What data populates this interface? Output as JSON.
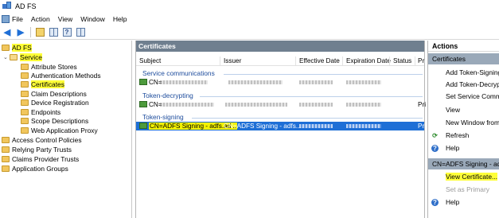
{
  "window": {
    "title": "AD FS"
  },
  "menu": [
    "File",
    "Action",
    "View",
    "Window",
    "Help"
  ],
  "tree": {
    "root": "AD FS",
    "service": "Service",
    "service_children": [
      "Attribute Stores",
      "Authentication Methods",
      "Certificates",
      "Claim Descriptions",
      "Device Registration",
      "Endpoints",
      "Scope Descriptions",
      "Web Application Proxy"
    ],
    "root_children": [
      "Access Control Policies",
      "Relying Party Trusts",
      "Claims Provider Trusts",
      "Application Groups"
    ]
  },
  "center": {
    "title": "Certificates",
    "columns": [
      "Subject",
      "Issuer",
      "Effective Date",
      "Expiration Date",
      "Status",
      "Pr"
    ],
    "groups": [
      {
        "label": "Service communications",
        "subject_prefix": "CN=",
        "issuer": "",
        "pr": ""
      },
      {
        "label": "Token-decrypting",
        "subject_prefix": "CN=",
        "issuer": "",
        "pr": "Pri"
      },
      {
        "label": "Token-signing",
        "subject": "CN=ADFS Signing - adfs.ad...",
        "issuer": "CN=ADFS Signing - adfs....",
        "pr": "Pri"
      }
    ]
  },
  "actions": {
    "title": "Actions",
    "group1": "Certificates",
    "items1": [
      "Add Token-Signing",
      "Add Token-Decrypti",
      "Set Service Commu",
      "View",
      "New Window from I",
      "Refresh",
      "Help"
    ],
    "group2": "CN=ADFS Signing - adfs",
    "items2": [
      "View Certificate...",
      "Set as Primary",
      "Help"
    ]
  }
}
